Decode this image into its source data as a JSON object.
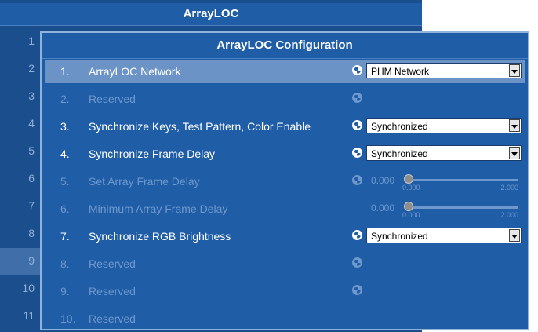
{
  "window": {
    "title": "ArrayLOC"
  },
  "background_rows": [
    "1",
    "2",
    "3",
    "4",
    "5",
    "6",
    "7",
    "8",
    "9",
    "10",
    "11"
  ],
  "dialog": {
    "title": "ArrayLOC Configuration",
    "rows": [
      {
        "num": "1.",
        "label": "ArrayLOC Network",
        "select": "PHM Network"
      },
      {
        "num": "2.",
        "label": "Reserved"
      },
      {
        "num": "3.",
        "label": "Synchronize Keys, Test Pattern, Color Enable",
        "select": "Synchronized"
      },
      {
        "num": "4.",
        "label": "Synchronize Frame Delay",
        "select": "Synchronized"
      },
      {
        "num": "5.",
        "label": "Set Array Frame Delay",
        "slider": {
          "value": "0.000",
          "min": "0.000",
          "max": "2.000"
        }
      },
      {
        "num": "6.",
        "label": "Minimum Array Frame Delay",
        "slider": {
          "value": "0.000",
          "min": "0.000",
          "max": "2.000"
        }
      },
      {
        "num": "7.",
        "label": "Synchronize RGB Brightness",
        "select": "Synchronized"
      },
      {
        "num": "8.",
        "label": "Reserved"
      },
      {
        "num": "9.",
        "label": "Reserved"
      },
      {
        "num": "10.",
        "label": "Reserved"
      }
    ]
  },
  "colors": {
    "panel": "#1b4e8c",
    "dialog": "#1f5da6",
    "selected_row": "#6b93c6",
    "disabled_text": "#6f98cd"
  }
}
